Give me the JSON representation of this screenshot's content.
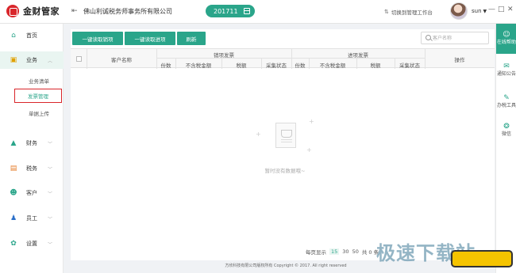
{
  "header": {
    "app_name": "金财管家",
    "collapse_icon": "collapse-arrow-icon",
    "company": "佛山利诚税务师事务所有限公司",
    "period": "201711",
    "switch_workbench": "切换到管理工作台",
    "user": "sun",
    "window_controls": {
      "minimize": "—",
      "restore": "□",
      "close": "✕"
    }
  },
  "sidebar": {
    "items": [
      {
        "label": "首页",
        "icon": "home-icon"
      },
      {
        "label": "业务",
        "icon": "business-icon"
      },
      {
        "label": "财务",
        "icon": "finance-icon"
      },
      {
        "label": "税务",
        "icon": "tax-icon"
      },
      {
        "label": "客户",
        "icon": "customer-icon"
      },
      {
        "label": "员工",
        "icon": "staff-icon"
      },
      {
        "label": "设置",
        "icon": "settings-icon"
      }
    ],
    "subitems": [
      {
        "label": "业务清单"
      },
      {
        "label": "发票管理"
      },
      {
        "label": "单据上传"
      }
    ]
  },
  "toolbar": {
    "read_sales": "一键读取销项",
    "read_input": "一键读取进项",
    "refresh": "刷新",
    "search_placeholder": "客户名称"
  },
  "table": {
    "customer_name": "客户名称",
    "sales_invoice": "销项发票",
    "input_invoice": "进项发票",
    "operation": "操作",
    "sub_headers": [
      "份数",
      "不含税金额",
      "税额",
      "采集状态",
      "份数",
      "不含税金额",
      "税额",
      "采集状态"
    ]
  },
  "empty_text": "暂时没有数据哦~",
  "pager": {
    "per_page_label": "每页显示",
    "sizes": [
      "15",
      "30",
      "50"
    ],
    "total": "共 0 条"
  },
  "footer": "方欣科技有限公司版权所有    Copyright  ©  2017. All right  reserved",
  "rail": [
    {
      "label": "在线帮助",
      "icon": "user-help-icon"
    },
    {
      "label": "通知公告",
      "icon": "chat-bubble-icon"
    },
    {
      "label": "办税工具",
      "icon": "wrench-icon"
    },
    {
      "label": "微信",
      "icon": "wechat-icon"
    }
  ],
  "watermark": "极速下载站",
  "colors": {
    "accent": "#2aa58a",
    "brand_red": "#d9262b",
    "highlight_border": "#d9262b"
  }
}
